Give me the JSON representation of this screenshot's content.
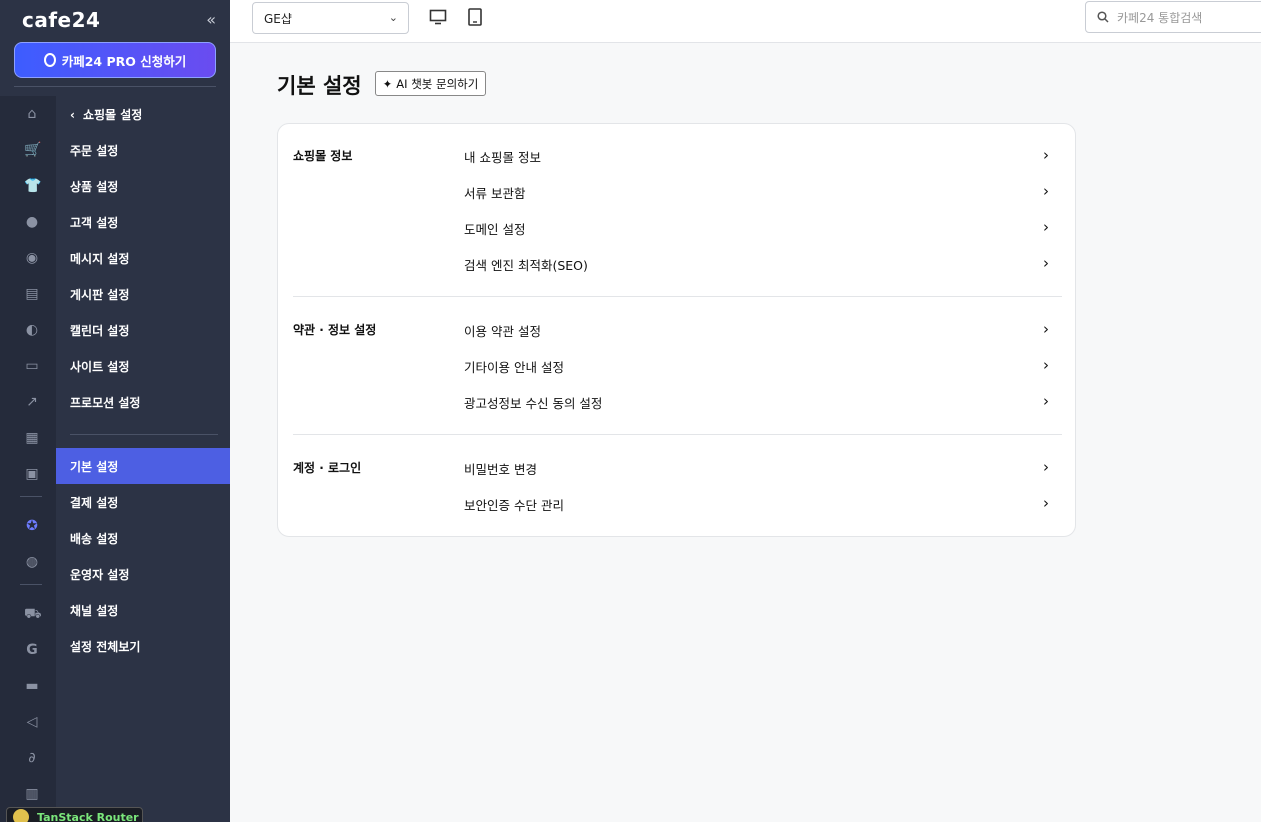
{
  "brand": "cafe24",
  "pro_button": "카페24 PRO 신청하기",
  "submenu": {
    "back_label": "쇼핑몰 설정",
    "group1": [
      "주문 설정",
      "상품 설정",
      "고객 설정",
      "메시지 설정",
      "게시판 설정",
      "캘린더 설정",
      "사이트 설정",
      "프로모션 설정"
    ],
    "group2": [
      "기본 설정",
      "결제 설정",
      "배송 설정",
      "운영자 설정",
      "채널 설정",
      "설정 전체보기"
    ],
    "active": "기본 설정"
  },
  "header": {
    "shop_select_value": "GE샵",
    "search_placeholder": "카페24 통합검색"
  },
  "page": {
    "title": "기본 설정",
    "ai_button": "AI 챗봇 문의하기"
  },
  "sections": [
    {
      "title": "쇼핑몰 정보",
      "links": [
        "내 쇼핑몰 정보",
        "서류 보관함",
        "도메인 설정",
        "검색 엔진 최적화(SEO)"
      ]
    },
    {
      "title": "약관 · 정보 설정",
      "links": [
        "이용 약관 설정",
        "기타이용 안내 설정",
        "광고성정보 수신 동의 설정"
      ]
    },
    {
      "title": "계정 · 로그인",
      "links": [
        "비밀번호 변경",
        "보안인증 수단 관리"
      ]
    }
  ],
  "devtools": {
    "label": "TanStack Router"
  },
  "colors": {
    "sidebar": "#2c3345",
    "active": "#4d5fe3",
    "accent": "#3d5dff"
  }
}
